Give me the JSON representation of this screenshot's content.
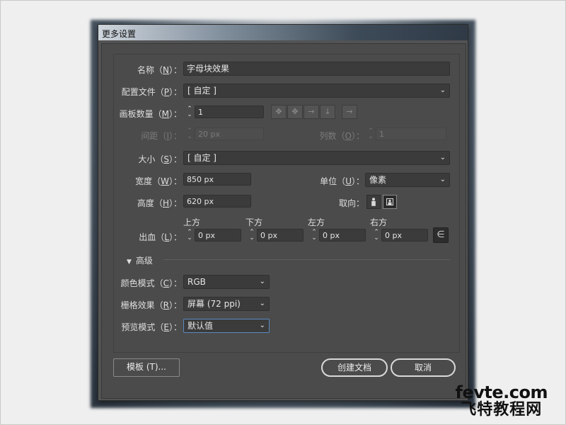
{
  "dialog": {
    "title": "更多设置"
  },
  "name": {
    "label": "名称",
    "key": "N",
    "value": "字母块效果"
  },
  "profile": {
    "label": "配置文件",
    "key": "P",
    "value": "[ 自定 ]"
  },
  "artboards": {
    "label": "画板数量",
    "key": "M",
    "value": "1"
  },
  "spacing": {
    "label": "间距",
    "key": "I",
    "value": "20 px"
  },
  "columns": {
    "label": "列数",
    "key": "O",
    "value": "1"
  },
  "size": {
    "label": "大小",
    "key": "S",
    "value": "[ 自定 ]"
  },
  "width": {
    "label": "宽度",
    "key": "W",
    "value": "850 px"
  },
  "units": {
    "label": "单位",
    "key": "U",
    "value": "像素"
  },
  "height": {
    "label": "高度",
    "key": "H",
    "value": "620 px"
  },
  "orientation": {
    "label": "取向",
    "selected": "landscape"
  },
  "bleed": {
    "label": "出血",
    "key": "L",
    "top": {
      "caption": "上方",
      "value": "0 px"
    },
    "bottom": {
      "caption": "下方",
      "value": "0 px"
    },
    "left": {
      "caption": "左方",
      "value": "0 px"
    },
    "right": {
      "caption": "右方",
      "value": "0 px"
    }
  },
  "advanced": {
    "label": "高级"
  },
  "color_mode": {
    "label": "颜色模式",
    "key": "C",
    "value": "RGB"
  },
  "raster": {
    "label": "栅格效果",
    "key": "R",
    "value": "屏幕 (72 ppi)"
  },
  "preview_mode": {
    "label": "预览模式",
    "key": "E",
    "value": "默认值"
  },
  "buttons": {
    "templates": "模板 (T)...",
    "create": "创建文档",
    "cancel": "取消"
  },
  "watermark": {
    "line1": "fevte.com",
    "line2": "飞特教程网"
  },
  "colors": {
    "dialog_bg": "#535353",
    "panel_bg": "#4b4b4b",
    "field_bg": "#3b3b3b",
    "focus": "#5a8ac0"
  }
}
